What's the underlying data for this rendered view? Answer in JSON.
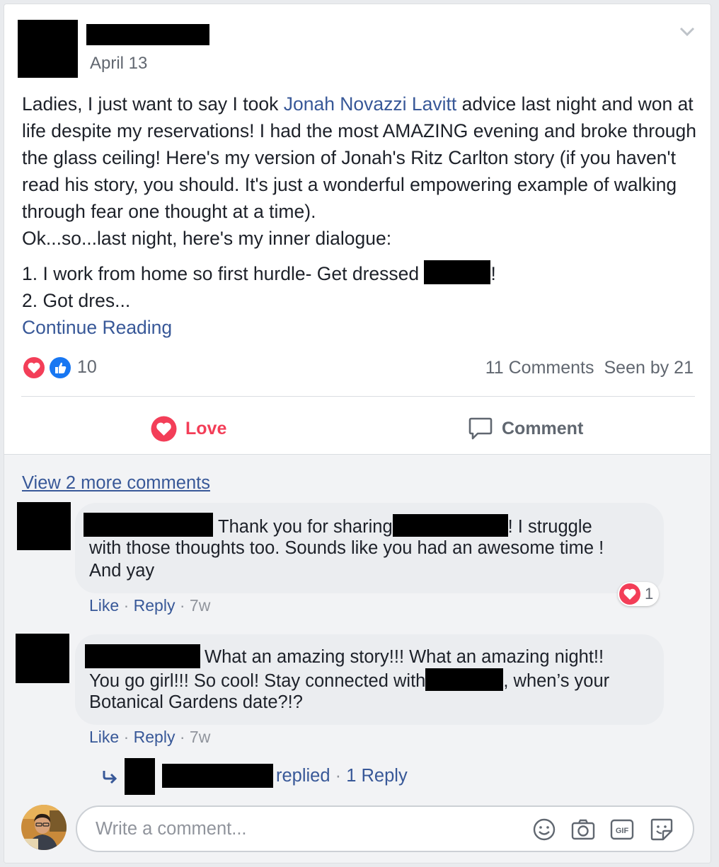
{
  "post": {
    "date": "April 13",
    "text_before_link": "Ladies, I just want to say I took ",
    "tagged_name": "Jonah Novazzi Lavitt",
    "text_after_link": " advice last night and won at life despite my reservations! I had the most AMAZING evening and broke through the glass ceiling! Here's my version of Jonah's Ritz Carlton story (if you haven't read his story, you should. It's just a wonderful empowering example of walking through fear one thought at a time).",
    "line_dialogue": "Ok...so...last night, here's my inner dialogue:",
    "list_line1_before": "1. I work from home so first hurdle- Get dressed ",
    "list_line1_after": "!",
    "list_line2": "2. Got dres...",
    "continue_label": "Continue Reading",
    "reaction_count": "10",
    "comments_count": "11 Comments",
    "seen_by": "Seen by 21"
  },
  "actions": {
    "love_label": "Love",
    "comment_label": "Comment"
  },
  "colors": {
    "love_red": "#f33e58",
    "like_blue": "#1877f2",
    "link_blue": "#385898"
  },
  "comments": {
    "view_more": "View 2 more comments",
    "items": [
      {
        "text_a": "Thank you for sharing",
        "text_b": "! I struggle",
        "text_c": "with those thoughts too. Sounds like you had an awesome time !",
        "text_d": "And yay",
        "like": "Like",
        "reply": "Reply",
        "time": "7w",
        "reaction_count": "1"
      },
      {
        "text_a": "What an amazing story!!! What an amazing night!!",
        "text_b": "You go girl!!! So cool! Stay connected with",
        "text_c": ", when’s your",
        "text_d": "Botanical Gardens date?!?",
        "like": "Like",
        "reply": "Reply",
        "time": "7w"
      }
    ],
    "replied_label": "replied",
    "reply_count_label": "1 Reply"
  },
  "composer": {
    "placeholder": "Write a comment..."
  },
  "icons": [
    "chevron-down-icon",
    "love-reaction-icon",
    "like-reaction-icon",
    "love-icon",
    "comment-icon",
    "reply-arrow-icon",
    "emoji-icon",
    "camera-icon",
    "gif-icon",
    "sticker-icon"
  ]
}
